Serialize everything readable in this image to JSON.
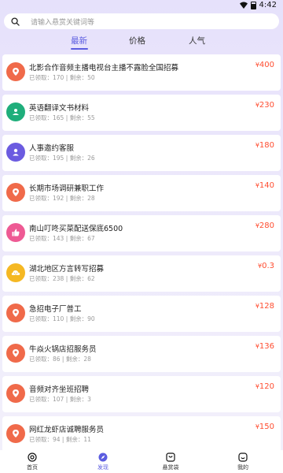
{
  "status": {
    "time": "4:42"
  },
  "search": {
    "placeholder": "请输入悬赏关键词等"
  },
  "tabs": [
    {
      "label": "最新",
      "active": true
    },
    {
      "label": "价格",
      "active": false
    },
    {
      "label": "人气",
      "active": false
    }
  ],
  "list": [
    {
      "title": "北影合作音频主播电视台主播不露脸全国招募",
      "meta": "已领取：170 | 剩余：50",
      "price": "400",
      "icon": "location-pin-icon",
      "color": "#f06a4a"
    },
    {
      "title": "英语翻译文书材料",
      "meta": "已领取：165 | 剩余：55",
      "price": "230",
      "icon": "person-card-icon",
      "color": "#1fae7b"
    },
    {
      "title": "人事邀约客服",
      "meta": "已领取：195 | 剩余：26",
      "price": "180",
      "icon": "person-icon",
      "color": "#6b5be0"
    },
    {
      "title": "长期市场调研兼职工作",
      "meta": "已领取：192 | 剩余：28",
      "price": "140",
      "icon": "location-pin-icon",
      "color": "#f06a4a"
    },
    {
      "title": "南山叮咚买菜配送保底6500",
      "meta": "已领取：143 | 剩余：67",
      "price": "280",
      "icon": "thumbs-up-icon",
      "color": "#ee5a94"
    },
    {
      "title": "湖北地区方言转写招募",
      "meta": "已领取：238 | 剩余：62",
      "price": "0.3",
      "icon": "smile-cloud-icon",
      "color": "#f5b823"
    },
    {
      "title": "急招电子厂普工",
      "meta": "已领取：110 | 剩余：90",
      "price": "128",
      "icon": "location-pin-icon",
      "color": "#f06a4a"
    },
    {
      "title": "牛焱火锅店招服务员",
      "meta": "已领取：86 | 剩余：28",
      "price": "136",
      "icon": "location-pin-icon",
      "color": "#f06a4a"
    },
    {
      "title": "音频对齐坐班招聘",
      "meta": "已领取：107 | 剩余：3",
      "price": "120",
      "icon": "location-pin-icon",
      "color": "#f06a4a"
    },
    {
      "title": "网红龙虾店诚聘服务员",
      "meta": "已领取：94 | 剩余：11",
      "price": "150",
      "icon": "location-pin-icon",
      "color": "#f06a4a"
    }
  ],
  "currency": "¥",
  "bottom_nav": [
    {
      "label": "首页",
      "icon": "home-icon"
    },
    {
      "label": "发现",
      "icon": "compass-icon",
      "active": true
    },
    {
      "label": "悬赏袋",
      "icon": "bag-icon"
    },
    {
      "label": "我的",
      "icon": "profile-icon"
    }
  ],
  "colors": {
    "accent": "#5b5ce0",
    "price": "#ff4d30"
  }
}
